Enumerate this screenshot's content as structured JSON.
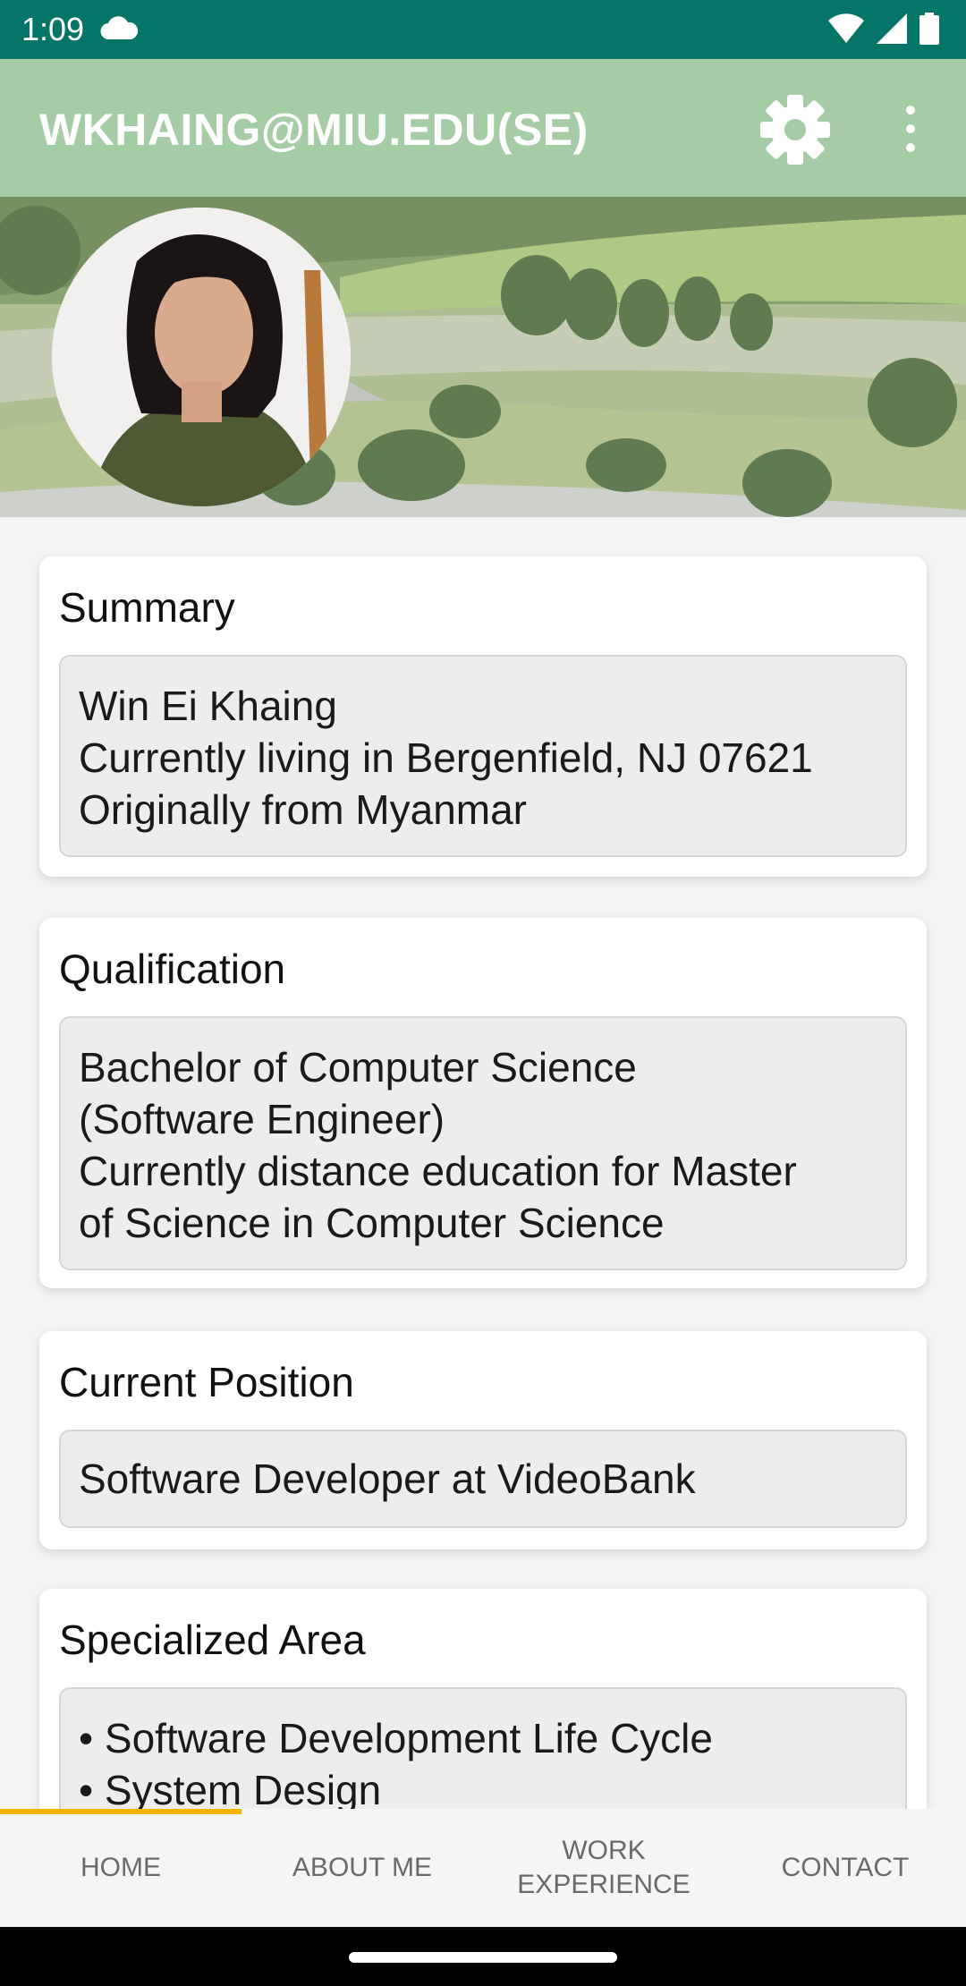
{
  "status_bar": {
    "time": "1:09",
    "icons": [
      "cloud-icon",
      "wifi-icon",
      "signal-icon",
      "battery-icon"
    ]
  },
  "toolbar": {
    "title": "WKHAING@MIU.EDU(SE)",
    "actions": [
      "gear-icon",
      "more-vert-icon"
    ]
  },
  "colors": {
    "status_bar": "#047566",
    "toolbar": "#a5cca5",
    "tab_indicator": "#f4b400"
  },
  "cards": {
    "summary": {
      "title": "Summary",
      "lines": [
        "Win Ei Khaing",
        "Currently living in Bergenfield, NJ 07621",
        "Originally from Myanmar"
      ]
    },
    "qualification": {
      "title": "Qualification",
      "lines": [
        "Bachelor of Computer Science",
        "(Software Engineer)",
        "Currently distance education for Master",
        "of Science in Computer Science"
      ]
    },
    "position": {
      "title": "Current Position",
      "lines": [
        "Software Developer at VideoBank"
      ]
    },
    "specialized": {
      "title": "Specialized Area",
      "lines": [
        "• Software Development Life Cycle",
        "• System Design"
      ]
    }
  },
  "bottom_nav": {
    "tabs": [
      {
        "label": "HOME",
        "selected": true
      },
      {
        "label": "ABOUT ME",
        "selected": false
      },
      {
        "label": "WORK",
        "label2": "EXPERIENCE",
        "selected": false
      },
      {
        "label": "CONTACT",
        "selected": false
      }
    ]
  }
}
